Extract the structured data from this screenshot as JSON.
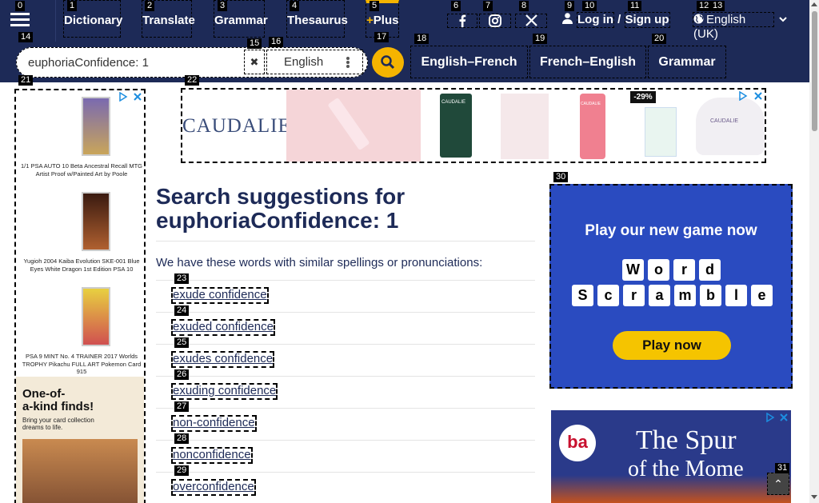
{
  "nav": {
    "menu_label": "",
    "links": [
      "Dictionary",
      "Translate",
      "Grammar",
      "Thesaurus"
    ],
    "plus": {
      "mark": "+",
      "label": "Plus"
    },
    "social": [
      "facebook-icon",
      "instagram-icon",
      "x-icon"
    ],
    "login": "Log in",
    "separator": "/",
    "signup": "Sign up",
    "language": "English (UK)"
  },
  "search": {
    "query": "euphoriaConfidence: 1",
    "clear_symbol": "✖",
    "dictionary": "English"
  },
  "tabs": [
    "English–French",
    "French–English",
    "Grammar"
  ],
  "colors": {
    "navy": "#1d2a57",
    "accent": "#f5b400"
  },
  "ads": {
    "left_captions": [
      "1/1 PSA AUTO 10 Beta Ancestral Recall MTG Artist Proof w/Painted Art by Poole",
      "Yugioh 2004 Kaiba Evolution SKE-001 Blue Eyes White Dragon 1st Edition PSA 10",
      "PSA 9 MINT No. 4 TRAINER 2017 Worlds TROPHY Pikachu FULL ART Pokemon Card 915"
    ],
    "left_promo_lines": [
      "One-of-",
      "a-kind finds!"
    ],
    "left_promo_sub": "Bring your card collection dreams to life.",
    "top_brand": "CAUDALIE",
    "top_discount": "-29%",
    "top_products": [
      "CAUDALIE",
      "CAUDALIE",
      "CAUDALIE"
    ],
    "game_heading": "Play our new game now",
    "game_tiles_row1": [
      "W",
      "o",
      "r",
      "d"
    ],
    "game_tiles_row2": [
      "S",
      "c",
      "r",
      "a",
      "m",
      "b",
      "l",
      "e"
    ],
    "game_button": "Play now",
    "right2_headline_1": "The Spur",
    "right2_headline_2": "of the Mome",
    "right2_logo": "ba"
  },
  "main": {
    "heading_prefix": "Search suggestions for",
    "heading_query": "euphoriaConfidence: 1",
    "intro": "We have these words with similar spellings or pronunciations:",
    "suggestions": [
      "exude confidence",
      "exuded confidence",
      "exudes confidence",
      "exuding confidence",
      "non-confidence",
      "nonconfidence",
      "overconfidence"
    ]
  },
  "marks": [
    "0",
    "1",
    "2",
    "3",
    "4",
    "5",
    "6",
    "7",
    "8",
    "9",
    "10",
    "11",
    "12",
    "13",
    "14",
    "15",
    "16",
    "17",
    "18",
    "19",
    "20",
    "21",
    "22",
    "23",
    "24",
    "25",
    "26",
    "27",
    "28",
    "29",
    "30",
    "31"
  ],
  "backtop_symbol": "⌃"
}
